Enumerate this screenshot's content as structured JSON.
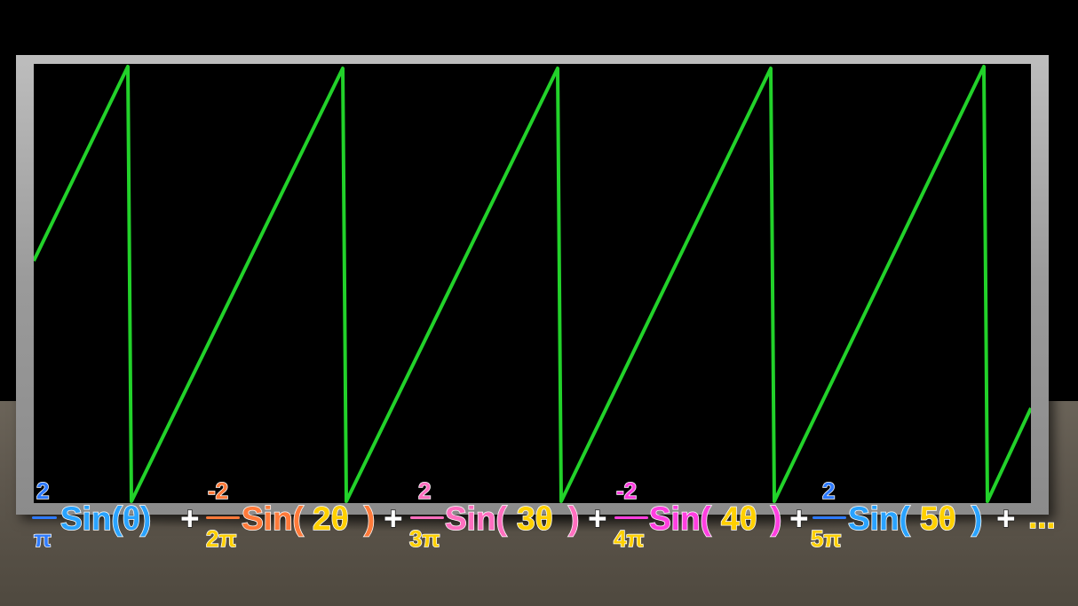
{
  "scene": {
    "description_colors": {
      "wave": "#22d22a",
      "screen": "#000000",
      "frame": "#a6a6a6",
      "floor": "#5e574d"
    }
  },
  "formula": {
    "term1": {
      "numerator": "2",
      "denominator": "π",
      "func": "Sin(θ)"
    },
    "op1": "+",
    "term2": {
      "numerator": "-2",
      "denominator": "2π",
      "func_prefix": "Sin(",
      "func_arg": "2θ",
      "func_suffix": ")"
    },
    "op2": "+",
    "term3": {
      "numerator": "2",
      "denominator": "3π",
      "func_prefix": "Sin(",
      "func_arg": "3θ",
      "func_suffix": ")"
    },
    "op3": "+",
    "term4": {
      "numerator": "-2",
      "denominator": "4π",
      "func_prefix": "Sin(",
      "func_arg": "4θ",
      "func_suffix": ")"
    },
    "op4": "+",
    "term5": {
      "numerator": "2",
      "denominator": "5π",
      "func_prefix": "Sin(",
      "func_arg": "5θ",
      "func_suffix": ")"
    },
    "op5": "+",
    "ellipsis": "..."
  }
}
